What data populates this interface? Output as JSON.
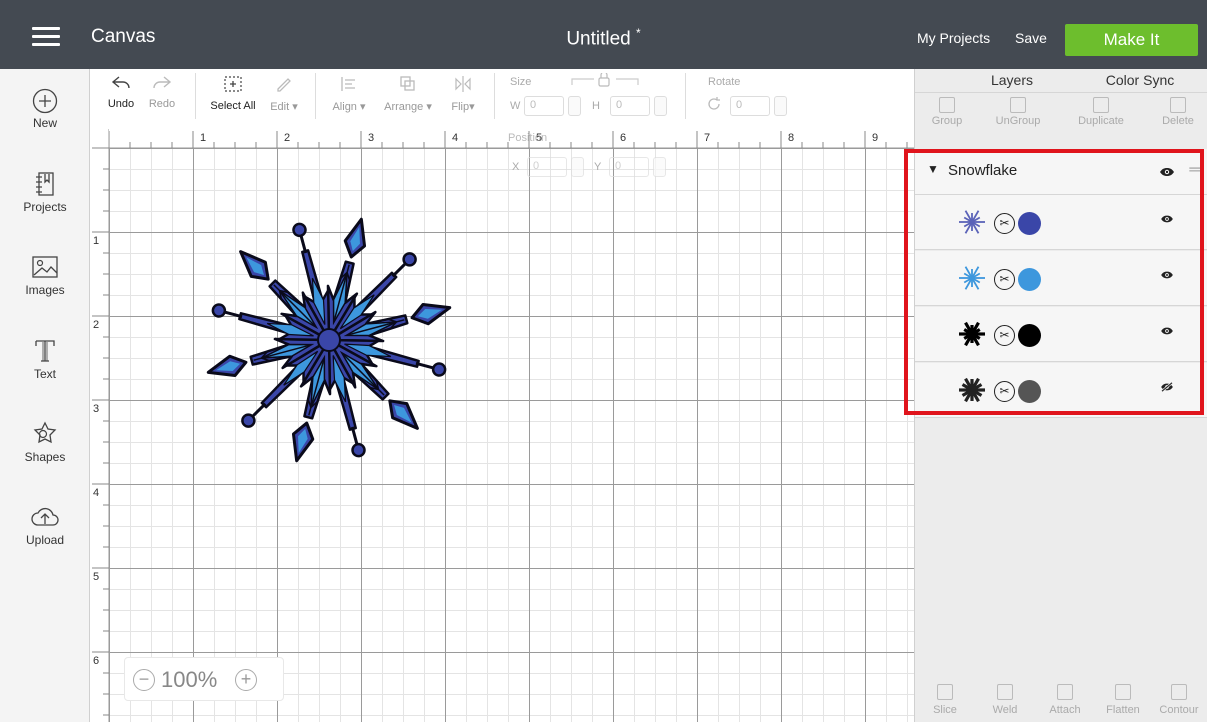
{
  "topbar": {
    "app_title": "Canvas",
    "doc_title": "Untitled",
    "doc_title_mark": "*",
    "my_projects": "My Projects",
    "save": "Save",
    "make_it": "Make It",
    "make_it_color": "#6dbe2d",
    "bar_color": "#444a52"
  },
  "sidebar": {
    "items": [
      {
        "label": "New",
        "icon": "plus-circle-icon"
      },
      {
        "label": "Projects",
        "icon": "projects-icon"
      },
      {
        "label": "Images",
        "icon": "image-icon"
      },
      {
        "label": "Text",
        "icon": "text-icon"
      },
      {
        "label": "Shapes",
        "icon": "shapes-icon"
      },
      {
        "label": "Upload",
        "icon": "upload-cloud-icon"
      }
    ]
  },
  "toolbar": {
    "undo": "Undo",
    "redo": "Redo",
    "select_all": "Select All",
    "edit": "Edit",
    "align": "Align",
    "arrange": "Arrange",
    "flip": "Flip",
    "size": "Size",
    "w": "W",
    "h": "H",
    "w_value": "0",
    "h_value": "0",
    "rotate": "Rotate",
    "rotate_value": "0",
    "position": "Position",
    "x": "X",
    "y": "Y",
    "x_value": "0",
    "y_value": "0"
  },
  "rulers": {
    "horizontal": [
      "1",
      "2",
      "3",
      "4",
      "5",
      "6",
      "7",
      "8",
      "9"
    ],
    "vertical": [
      "1",
      "2",
      "3",
      "4",
      "5",
      "6"
    ]
  },
  "zoom": {
    "minus": "−",
    "level": "100%",
    "plus": "+"
  },
  "right_panel": {
    "tabs": [
      "Layers",
      "Color Sync"
    ],
    "tools": [
      "Group",
      "UnGroup",
      "Duplicate",
      "Delete"
    ],
    "group_name": "Snowflake",
    "layers": [
      {
        "color": "#3a46a8",
        "visible": true,
        "thumb_color": "#5b63b8"
      },
      {
        "color": "#3d97dd",
        "visible": true,
        "thumb_color": "#3d97dd"
      },
      {
        "color": "#000000",
        "visible": true,
        "thumb_color": "#000000"
      },
      {
        "color": "#555555",
        "visible": false,
        "thumb_color": "#222222"
      }
    ],
    "cut_symbol": "✂",
    "bottom_tools": [
      "Slice",
      "Weld",
      "Attach",
      "Flatten",
      "Contour"
    ]
  },
  "highlight_color": "#e0141c"
}
